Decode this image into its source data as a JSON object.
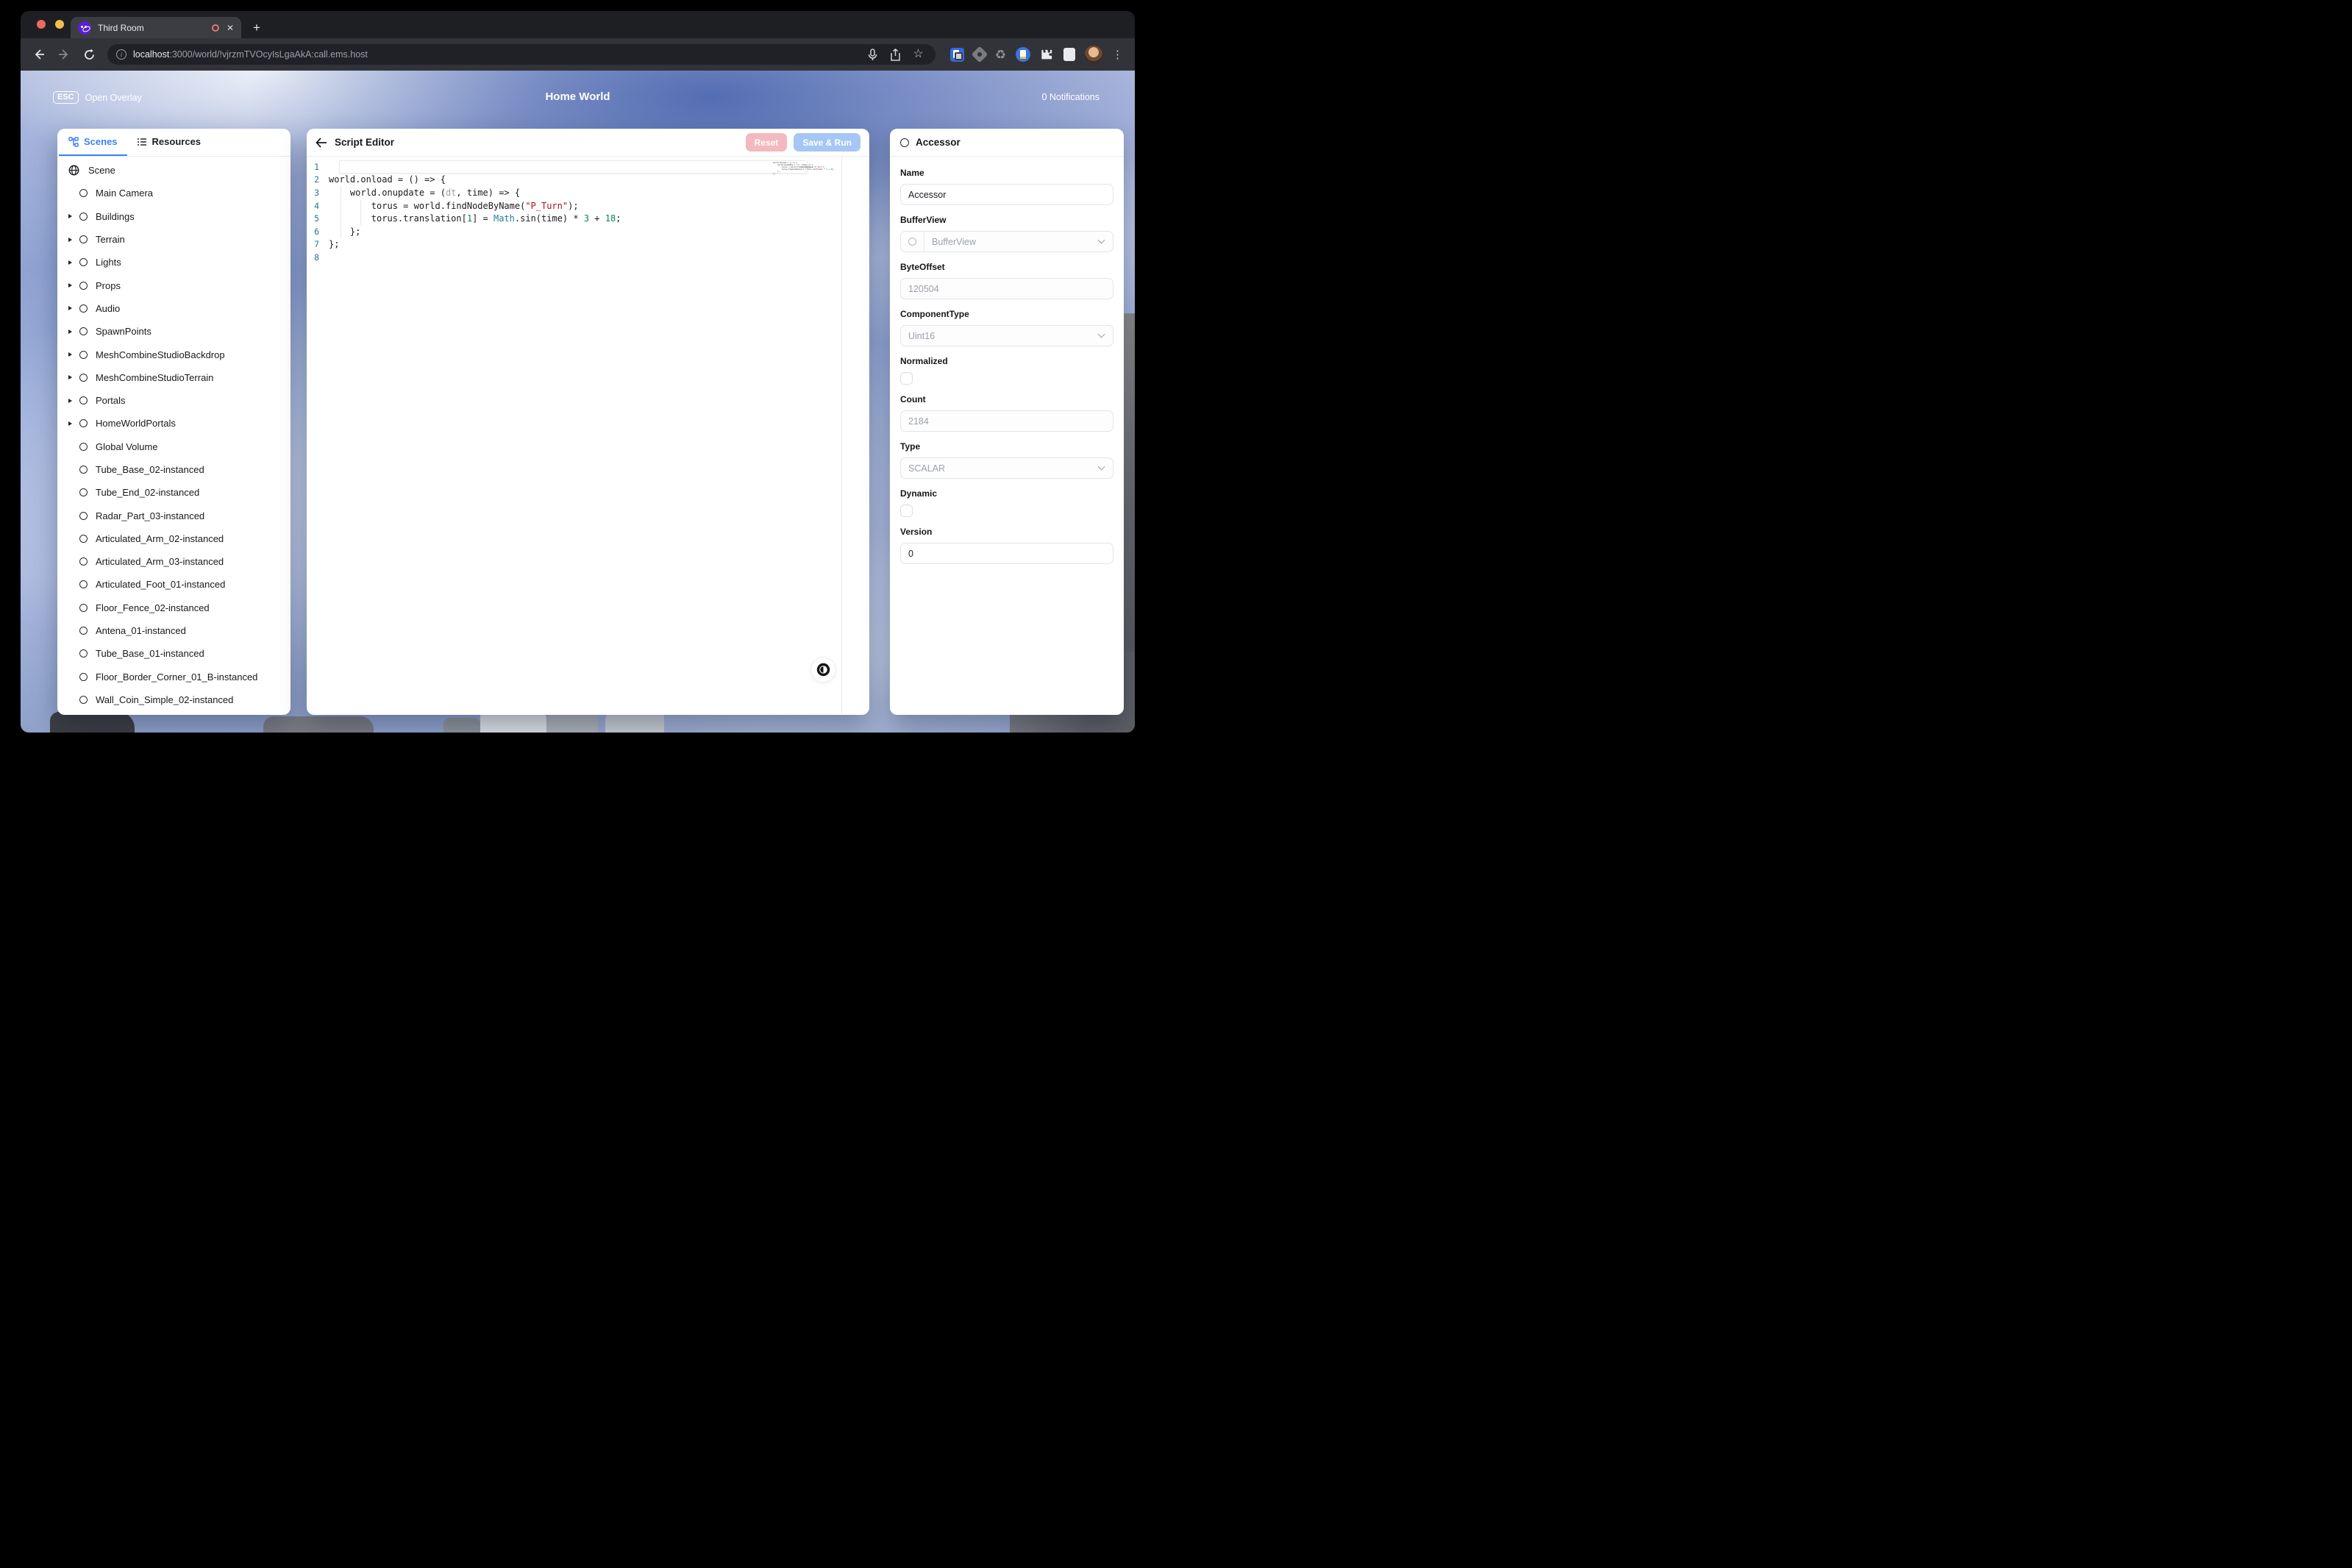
{
  "browser": {
    "tab": {
      "title": "Third Room"
    },
    "url": {
      "host": "localhost",
      "rest": ":3000/world/!vjrzmTVOcyIsLgaAkA:call.ems.host"
    },
    "icons": {
      "close_tab": "✕",
      "new_tab": "+",
      "menu_dots": "⋮",
      "star": "☆",
      "recycle": "♻",
      "info": "i"
    }
  },
  "topbar": {
    "esc_key": "ESC",
    "open_overlay": "Open Overlay",
    "title": "Home World",
    "notifications": "0 Notifications"
  },
  "left_panel": {
    "tabs": [
      {
        "label": "Scenes",
        "active": true
      },
      {
        "label": "Resources",
        "active": false
      }
    ],
    "root_label": "Scene",
    "items": [
      {
        "label": "Main Camera",
        "caret": false
      },
      {
        "label": "Buildings",
        "caret": true
      },
      {
        "label": "Terrain",
        "caret": true
      },
      {
        "label": "Lights",
        "caret": true
      },
      {
        "label": "Props",
        "caret": true
      },
      {
        "label": "Audio",
        "caret": true
      },
      {
        "label": "SpawnPoints",
        "caret": true
      },
      {
        "label": "MeshCombineStudioBackdrop",
        "caret": true
      },
      {
        "label": "MeshCombineStudioTerrain",
        "caret": true
      },
      {
        "label": "Portals",
        "caret": true
      },
      {
        "label": "HomeWorldPortals",
        "caret": true
      },
      {
        "label": "Global Volume",
        "caret": false
      },
      {
        "label": "Tube_Base_02-instanced",
        "caret": false
      },
      {
        "label": "Tube_End_02-instanced",
        "caret": false
      },
      {
        "label": "Radar_Part_03-instanced",
        "caret": false
      },
      {
        "label": "Articulated_Arm_02-instanced",
        "caret": false
      },
      {
        "label": "Articulated_Arm_03-instanced",
        "caret": false
      },
      {
        "label": "Articulated_Foot_01-instanced",
        "caret": false
      },
      {
        "label": "Floor_Fence_02-instanced",
        "caret": false
      },
      {
        "label": "Antena_01-instanced",
        "caret": false
      },
      {
        "label": "Tube_Base_01-instanced",
        "caret": false
      },
      {
        "label": "Floor_Border_Corner_01_B-instanced",
        "caret": false
      },
      {
        "label": "Wall_Coin_Simple_02-instanced",
        "caret": false
      }
    ]
  },
  "editor": {
    "title": "Script Editor",
    "reset_label": "Reset",
    "save_run_label": "Save & Run",
    "lines": [
      {
        "n": "1",
        "current": true,
        "tokens": []
      },
      {
        "n": "2",
        "tokens": [
          [
            "d",
            "world.onload = () => {"
          ]
        ]
      },
      {
        "n": "3",
        "tokens": [
          [
            "d",
            "    world.onupdate = ("
          ],
          [
            "p",
            "dt"
          ],
          [
            "d",
            ", time) => {"
          ]
        ]
      },
      {
        "n": "4",
        "tokens": [
          [
            "d",
            "        torus = world.findNodeByName("
          ],
          [
            "s",
            "\"P_Turn\""
          ],
          [
            "d",
            ");"
          ]
        ]
      },
      {
        "n": "5",
        "tokens": [
          [
            "d",
            "        torus.translation["
          ],
          [
            "n",
            "1"
          ],
          [
            "d",
            "] = "
          ],
          [
            "t",
            "Math"
          ],
          [
            "d",
            ".sin(time) * "
          ],
          [
            "n",
            "3"
          ],
          [
            "d",
            " + "
          ],
          [
            "n",
            "18"
          ],
          [
            "d",
            ";"
          ]
        ]
      },
      {
        "n": "6",
        "tokens": [
          [
            "d",
            "    };"
          ]
        ]
      },
      {
        "n": "7",
        "tokens": [
          [
            "d",
            "};"
          ]
        ]
      },
      {
        "n": "8",
        "tokens": []
      }
    ]
  },
  "inspector": {
    "title": "Accessor",
    "fields": [
      {
        "label": "Name",
        "control": "input",
        "value": "Accessor",
        "muted": false
      },
      {
        "label": "BufferView",
        "control": "select-ref",
        "value": "BufferView",
        "muted": true
      },
      {
        "label": "ByteOffset",
        "control": "input",
        "value": "120504",
        "muted": true
      },
      {
        "label": "ComponentType",
        "control": "select",
        "value": "Uint16",
        "muted": true
      },
      {
        "label": "Normalized",
        "control": "checkbox",
        "checked": false
      },
      {
        "label": "Count",
        "control": "input",
        "value": "2184",
        "muted": true
      },
      {
        "label": "Type",
        "control": "select",
        "value": "SCALAR",
        "muted": true
      },
      {
        "label": "Dynamic",
        "control": "checkbox",
        "checked": false
      },
      {
        "label": "Version",
        "control": "input",
        "value": "0",
        "muted": false
      }
    ]
  },
  "colors": {
    "accent_blue": "#3b82f6",
    "reset_button_bg": "#f4b9be",
    "save_button_bg": "#a6c6f4",
    "line_number": "#237893",
    "code_string": "#a31515",
    "code_type": "#267f99",
    "code_number": "#098658"
  }
}
